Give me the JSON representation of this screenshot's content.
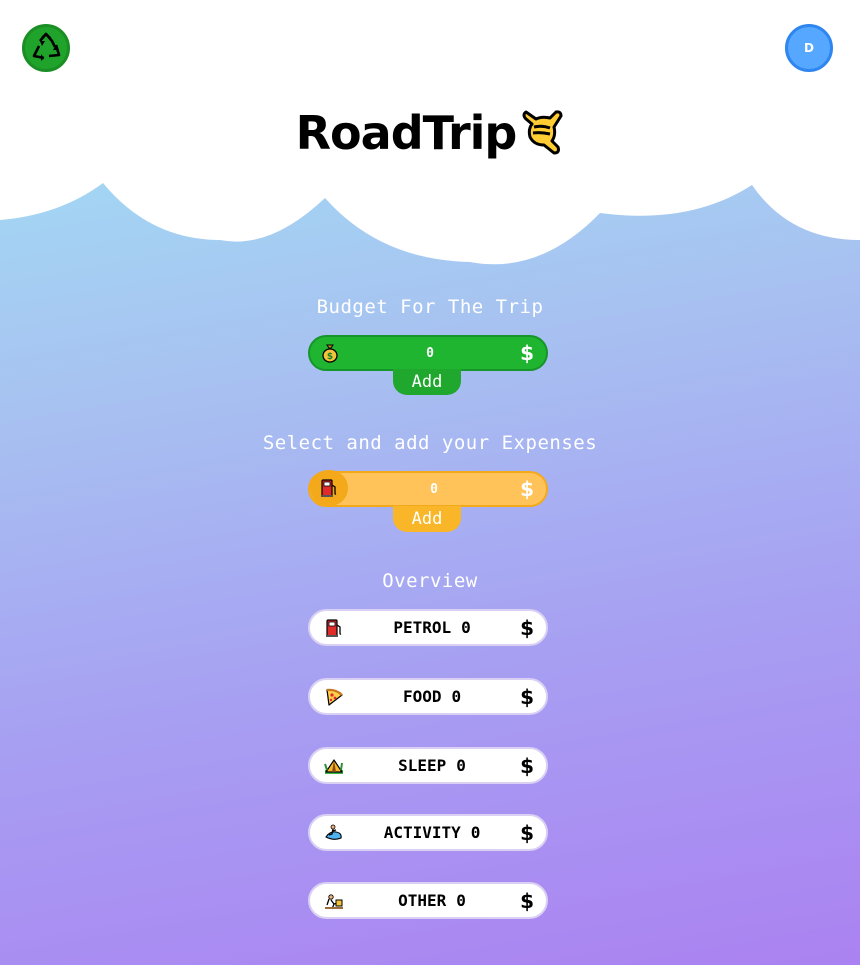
{
  "header": {
    "title": "RoadTrip",
    "avatar_initial": "D"
  },
  "budget": {
    "label": "Budget For The Trip",
    "value": "0",
    "currency": "$",
    "add_label": "Add"
  },
  "expenses": {
    "label": "Select and add your Expenses",
    "value": "0",
    "currency": "$",
    "add_label": "Add",
    "selected_icon": "fuel-pump-icon"
  },
  "overview": {
    "label": "Overview",
    "items": [
      {
        "name": "PETROL",
        "amount": "0",
        "currency": "$",
        "icon": "fuel-pump-icon"
      },
      {
        "name": "FOOD",
        "amount": "0",
        "currency": "$",
        "icon": "pizza-icon"
      },
      {
        "name": "SLEEP",
        "amount": "0",
        "currency": "$",
        "icon": "tent-icon"
      },
      {
        "name": "ACTIVITY",
        "amount": "0",
        "currency": "$",
        "icon": "surf-icon"
      },
      {
        "name": "OTHER",
        "amount": "0",
        "currency": "$",
        "icon": "misc-icon"
      }
    ]
  },
  "colors": {
    "budget_green": "#20b530",
    "expense_yellow": "#ffc35a",
    "avatar_blue": "#55a7ff"
  }
}
